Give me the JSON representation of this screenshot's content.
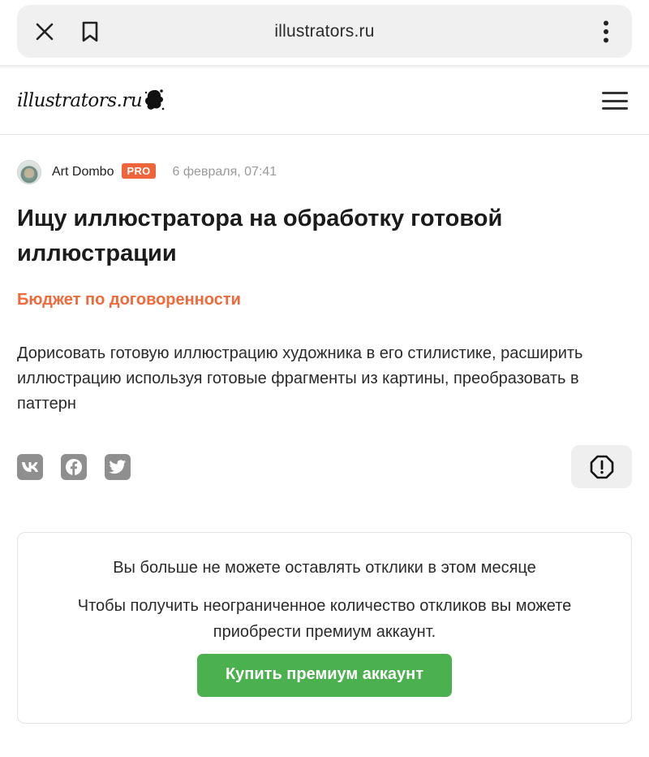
{
  "browser": {
    "url": "illustrators.ru",
    "close_icon": "close-icon",
    "bookmark_icon": "bookmark-icon",
    "menu_icon": "more-vert-icon"
  },
  "site": {
    "logo_text": "illustrators.ru",
    "menu_icon": "hamburger-menu-icon"
  },
  "post": {
    "author": "Art Dombo",
    "badge": "PRO",
    "date": "6 февраля, 07:41",
    "title": "Ищу иллюстратора на обработку готовой иллюстрации",
    "budget": "Бюджет по договоренности",
    "description": "Дорисовать готовую иллюстрацию художника в его стилистике, расширить иллюстрацию используя готовые фрагменты из картины, преобразовать в паттерн"
  },
  "share": {
    "items": [
      {
        "name": "vk-icon",
        "glyph": "VK"
      },
      {
        "name": "facebook-icon",
        "glyph": "f"
      },
      {
        "name": "twitter-icon",
        "glyph": "t"
      }
    ],
    "report_icon": "alert-icon"
  },
  "notice": {
    "title": "Вы больше не можете оставлять отклики в этом месяце",
    "text": "Чтобы получить неограниченное количество откликов вы можете приобрести премиум аккаунт.",
    "button": "Купить премиум аккаунт"
  },
  "colors": {
    "accent_orange": "#ee6a3a",
    "badge_orange": "#f0643a",
    "button_green": "#4bb04e",
    "muted_gray": "#9a9a9a"
  }
}
